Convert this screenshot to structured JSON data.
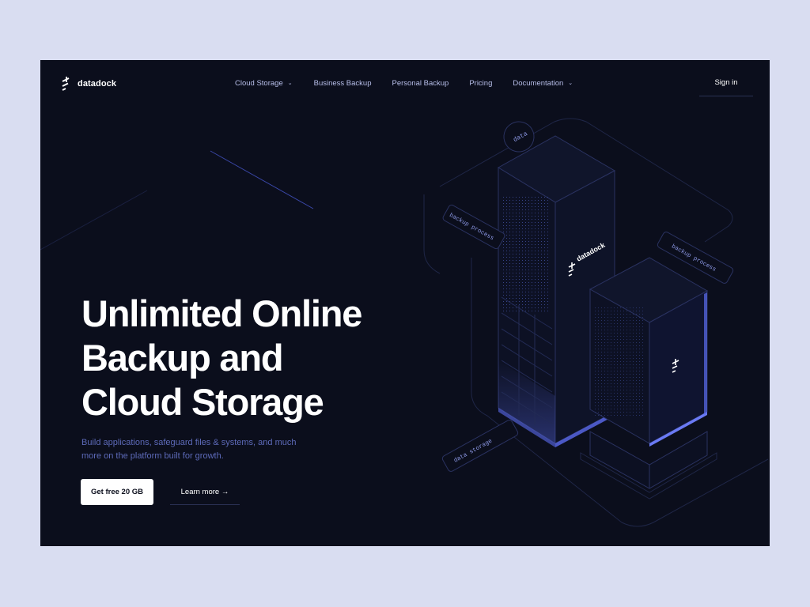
{
  "brand": {
    "name": "datadock"
  },
  "nav": {
    "items": [
      {
        "label": "Cloud Storage",
        "has_dropdown": true
      },
      {
        "label": "Business Backup",
        "has_dropdown": false
      },
      {
        "label": "Personal Backup",
        "has_dropdown": false
      },
      {
        "label": "Pricing",
        "has_dropdown": false
      },
      {
        "label": "Documentation",
        "has_dropdown": true
      }
    ],
    "sign_in": "Sign in"
  },
  "hero": {
    "headline_lines": [
      "Unlimited Online",
      "Backup and",
      "Cloud Storage"
    ],
    "subtext": "Build applications, safeguard files & systems, and much more on the platform built for growth.",
    "primary_cta": "Get free 20 GB",
    "secondary_cta": "Learn more →"
  },
  "illustration": {
    "tags": {
      "data": "data",
      "backup_left": "backup process",
      "backup_right": "backup process",
      "storage": "data storage"
    },
    "server_label": "datadock"
  },
  "colors": {
    "background": "#0b0e1c",
    "page": "#d9ddf1",
    "accent": "#5b6cf0",
    "muted_text": "#5d6ab9"
  },
  "icons": {
    "dropdown": "chevron-down-icon",
    "logo": "datadock-logo-icon"
  }
}
